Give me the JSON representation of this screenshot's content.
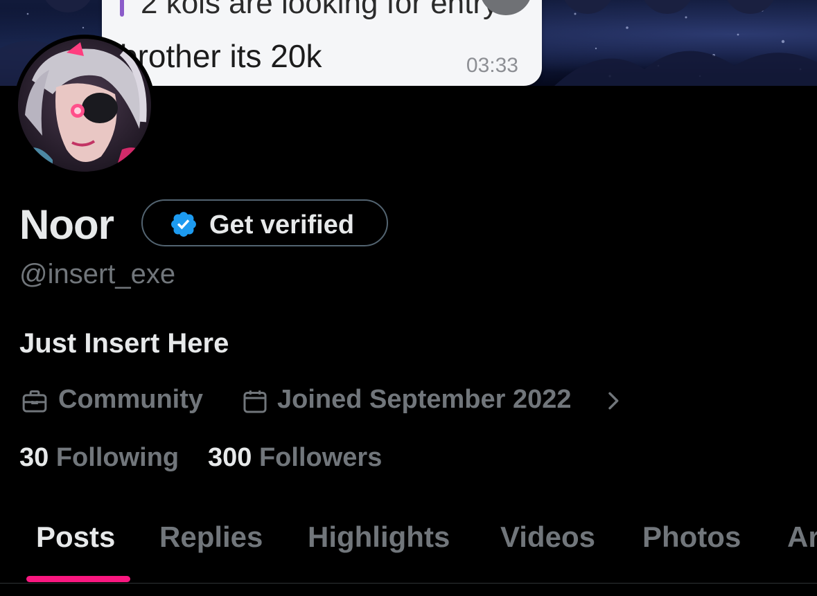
{
  "banner": {
    "chat": {
      "quoted_text": "2 kols are looking for entry",
      "message": "brother its 20k",
      "time": "03:33"
    }
  },
  "profile": {
    "name": "Noor",
    "verify_button_label": "Get verified",
    "handle": "@insert_exe",
    "bio": "Just Insert Here",
    "category": "Community",
    "joined": "Joined September 2022",
    "following_count": "30",
    "following_label": "Following",
    "followers_count": "300",
    "followers_label": "Followers"
  },
  "tabs": [
    {
      "label": "Posts",
      "active": true
    },
    {
      "label": "Replies",
      "active": false
    },
    {
      "label": "Highlights",
      "active": false
    },
    {
      "label": "Videos",
      "active": false
    },
    {
      "label": "Photos",
      "active": false
    },
    {
      "label": "Ar",
      "active": false
    }
  ],
  "icons": {
    "verified": "verified-badge-icon",
    "category": "briefcase-icon",
    "joined": "calendar-icon",
    "joined_more": "chevron-right-icon"
  },
  "colors": {
    "accent": "#f91880",
    "verified_blue": "#1d9bf0",
    "secondary_text": "#71767b",
    "primary_text": "#e7e9ea",
    "background": "#000000"
  }
}
